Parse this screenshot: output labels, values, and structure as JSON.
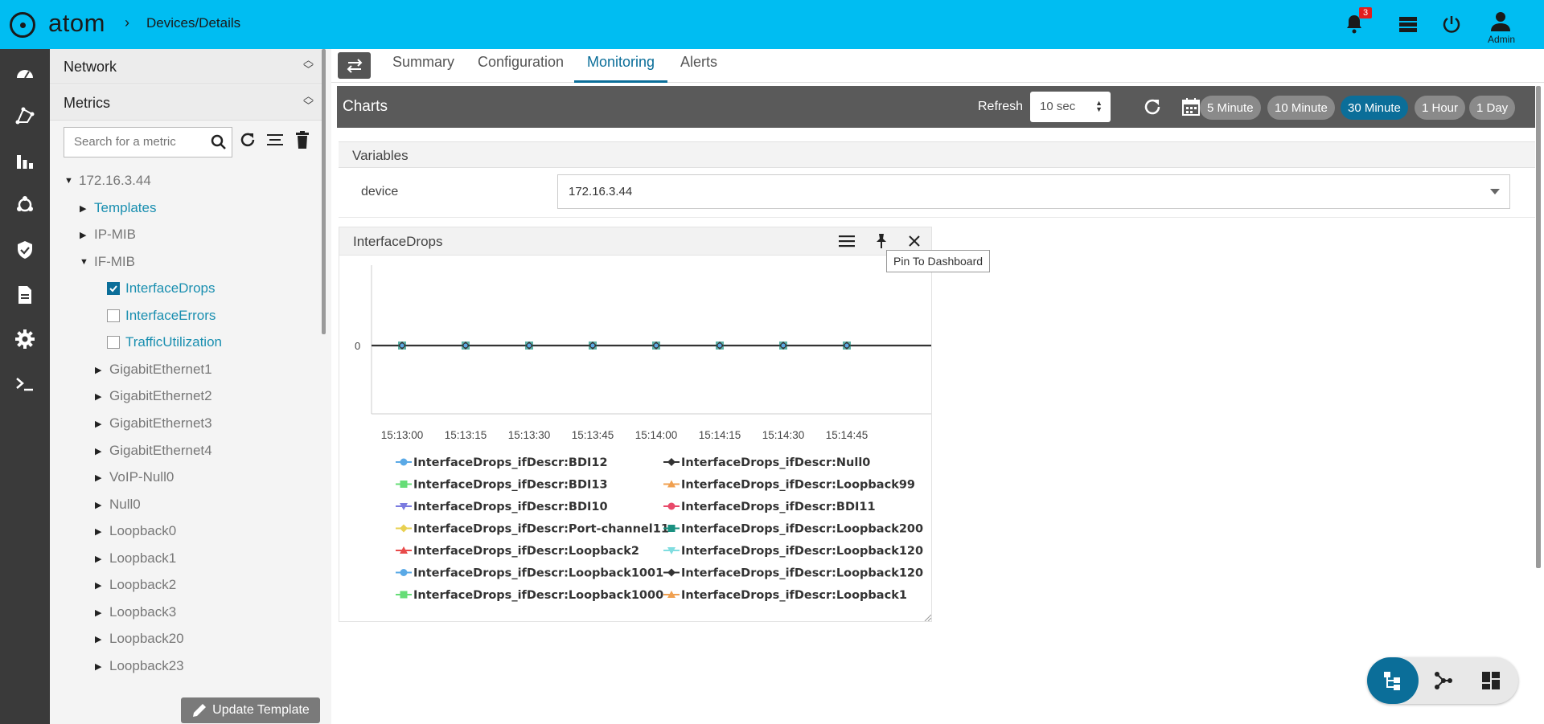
{
  "app": {
    "logo_text": "atom",
    "breadcrumb": "Devices/Details"
  },
  "header": {
    "notification_count": "3",
    "user_label": "Admin"
  },
  "rail": {
    "items": [
      "dashboard-icon",
      "topology-icon",
      "analytics-icon",
      "automation-icon",
      "security-icon",
      "documents-icon",
      "settings-icon",
      "terminal-icon"
    ]
  },
  "tree_panel": {
    "network_label": "Network",
    "metrics_label": "Metrics",
    "search_placeholder": "Search for a metric",
    "root": "172.16.3.44",
    "nodes": {
      "templates": "Templates",
      "ip_mib": "IP-MIB",
      "if_mib": "IF-MIB",
      "interface_drops": "InterfaceDrops",
      "interface_errors": "InterfaceErrors",
      "traffic_utilization": "TrafficUtilization",
      "ge1": "GigabitEthernet1",
      "ge2": "GigabitEthernet2",
      "ge3": "GigabitEthernet3",
      "ge4": "GigabitEthernet4",
      "voip": "VoIP-Null0",
      "null0": "Null0",
      "lb0": "Loopback0",
      "lb1": "Loopback1",
      "lb2": "Loopback2",
      "lb3": "Loopback3",
      "lb20": "Loopback20",
      "lb23": "Loopback23"
    },
    "checked": {
      "interface_drops": true,
      "interface_errors": false,
      "traffic_utilization": false
    },
    "update_button": "Update Template"
  },
  "tabs": {
    "summary": "Summary",
    "configuration": "Configuration",
    "monitoring": "Monitoring",
    "alerts": "Alerts",
    "active": "Monitoring"
  },
  "charts_bar": {
    "title": "Charts",
    "refresh_label": "Refresh",
    "refresh_value": "10 sec",
    "ranges": [
      "5 Minute",
      "10 Minute",
      "30 Minute",
      "1 Hour",
      "1 Day"
    ],
    "active_range": "30 Minute"
  },
  "variables": {
    "title": "Variables",
    "device_label": "device",
    "device_value": "172.16.3.44"
  },
  "chart_panel": {
    "title": "InterfaceDrops",
    "tooltip": "Pin To Dashboard"
  },
  "chart_data": {
    "type": "line",
    "title": "InterfaceDrops",
    "xlabel": "",
    "ylabel": "",
    "x": [
      "15:13:00",
      "15:13:15",
      "15:13:30",
      "15:13:45",
      "15:14:00",
      "15:14:15",
      "15:14:30",
      "15:14:45"
    ],
    "y_ticks": [
      "0"
    ],
    "grid": false,
    "legend_position": "bottom",
    "series": [
      {
        "name": "InterfaceDrops_ifDescr:BDI12",
        "color": "#5aa9e6",
        "marker": "circle",
        "values": [
          0,
          0,
          0,
          0,
          0,
          0,
          0,
          0
        ]
      },
      {
        "name": "InterfaceDrops_ifDescr:Null0",
        "color": "#333333",
        "marker": "diamond",
        "values": [
          0,
          0,
          0,
          0,
          0,
          0,
          0,
          0
        ]
      },
      {
        "name": "InterfaceDrops_ifDescr:BDI13",
        "color": "#66dd77",
        "marker": "square",
        "values": [
          0,
          0,
          0,
          0,
          0,
          0,
          0,
          0
        ]
      },
      {
        "name": "InterfaceDrops_ifDescr:Loopback99",
        "color": "#f0a050",
        "marker": "triangle",
        "values": [
          0,
          0,
          0,
          0,
          0,
          0,
          0,
          0
        ]
      },
      {
        "name": "InterfaceDrops_ifDescr:BDI10",
        "color": "#7b7be0",
        "marker": "triangle-down",
        "values": [
          0,
          0,
          0,
          0,
          0,
          0,
          0,
          0
        ]
      },
      {
        "name": "InterfaceDrops_ifDescr:BDI11",
        "color": "#e84a6a",
        "marker": "circle",
        "values": [
          0,
          0,
          0,
          0,
          0,
          0,
          0,
          0
        ]
      },
      {
        "name": "InterfaceDrops_ifDescr:Port-channel11",
        "color": "#e8d050",
        "marker": "diamond",
        "values": [
          0,
          0,
          0,
          0,
          0,
          0,
          0,
          0
        ]
      },
      {
        "name": "InterfaceDrops_ifDescr:Loopback200",
        "color": "#1a9080",
        "marker": "square",
        "values": [
          0,
          0,
          0,
          0,
          0,
          0,
          0,
          0
        ]
      },
      {
        "name": "InterfaceDrops_ifDescr:Loopback2",
        "color": "#e84a4a",
        "marker": "triangle",
        "values": [
          0,
          0,
          0,
          0,
          0,
          0,
          0,
          0
        ]
      },
      {
        "name": "InterfaceDrops_ifDescr:Loopback120",
        "color": "#80dde0",
        "marker": "triangle-down",
        "values": [
          0,
          0,
          0,
          0,
          0,
          0,
          0,
          0
        ]
      },
      {
        "name": "InterfaceDrops_ifDescr:Loopback1001",
        "color": "#5aa9e6",
        "marker": "circle",
        "values": [
          0,
          0,
          0,
          0,
          0,
          0,
          0,
          0
        ]
      },
      {
        "name": "InterfaceDrops_ifDescr:Loopback120",
        "color": "#333333",
        "marker": "diamond",
        "values": [
          0,
          0,
          0,
          0,
          0,
          0,
          0,
          0
        ]
      },
      {
        "name": "InterfaceDrops_ifDescr:Loopback1000",
        "color": "#66dd77",
        "marker": "square",
        "values": [
          0,
          0,
          0,
          0,
          0,
          0,
          0,
          0
        ]
      },
      {
        "name": "InterfaceDrops_ifDescr:Loopback1",
        "color": "#f0a050",
        "marker": "triangle",
        "values": [
          0,
          0,
          0,
          0,
          0,
          0,
          0,
          0
        ]
      }
    ]
  },
  "colors": {
    "topbar": "#00bdf2",
    "accent": "#0b6e99",
    "rail": "#3a3a3a"
  }
}
